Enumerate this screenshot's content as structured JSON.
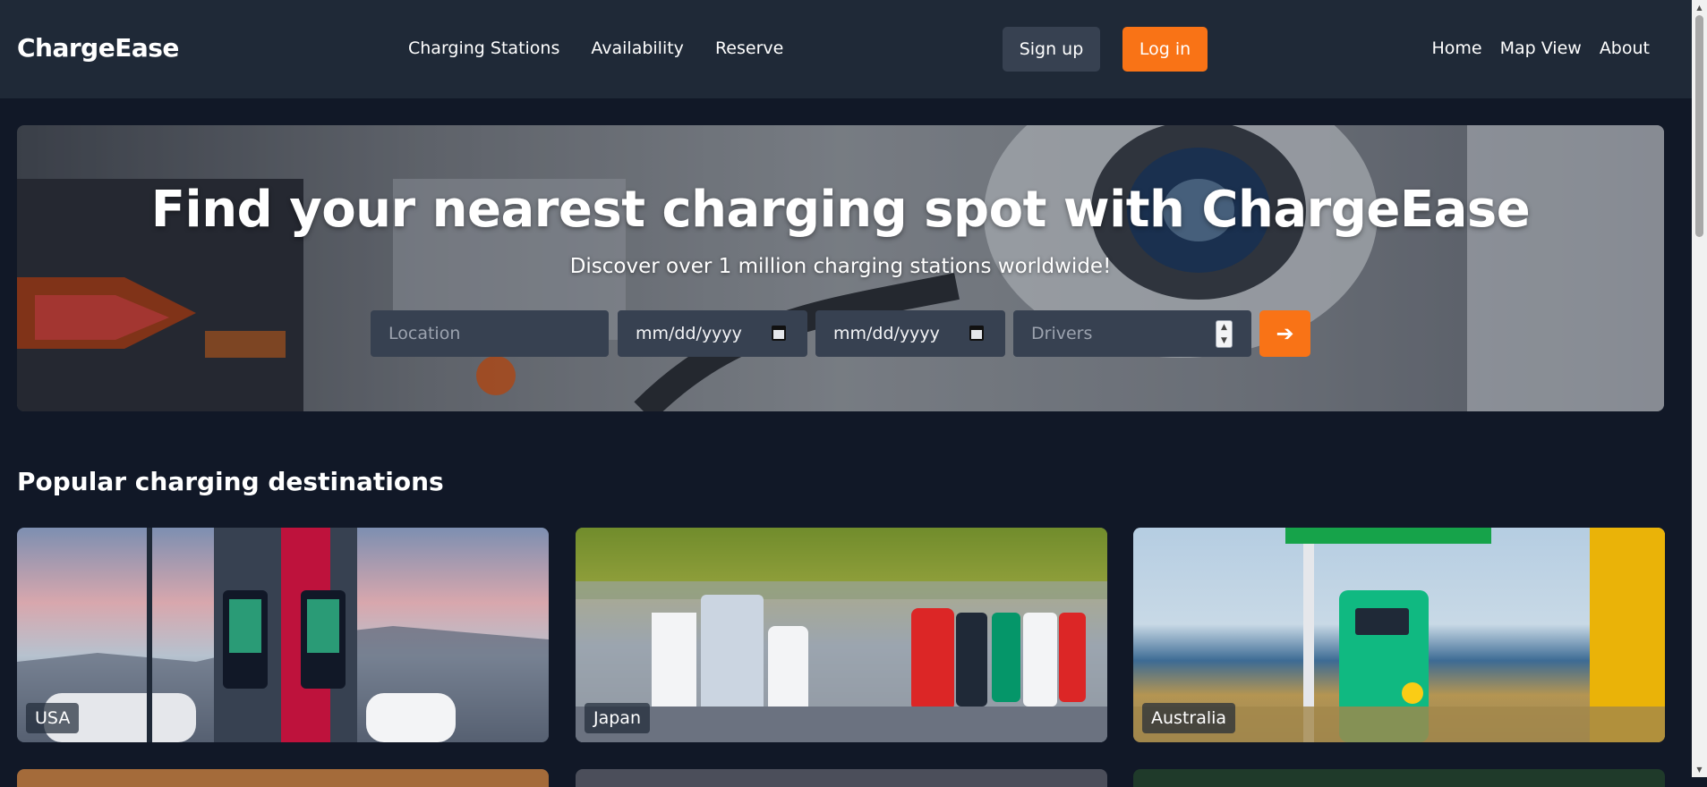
{
  "header": {
    "brand": "ChargeEase",
    "nav_center": [
      "Charging Stations",
      "Availability",
      "Reserve"
    ],
    "signup_label": "Sign up",
    "login_label": "Log in",
    "nav_right": [
      "Home",
      "Map View",
      "About"
    ]
  },
  "hero": {
    "title": "Find your nearest charging spot with ChargeEase",
    "subtitle": "Discover over 1 million charging stations worldwide!",
    "location_placeholder": "Location",
    "start_date": "mm/dd/yyyy",
    "end_date": "mm/dd/yyyy",
    "drivers_placeholder": "Drivers",
    "submit_icon": "arrow-right-icon"
  },
  "destinations": {
    "title": "Popular charging destinations",
    "cards": [
      {
        "label": "USA"
      },
      {
        "label": "Japan"
      },
      {
        "label": "Australia"
      }
    ]
  },
  "colors": {
    "accent": "#f97316",
    "header_bg": "#1f2937",
    "page_bg": "#111827",
    "input_bg": "#374151"
  }
}
